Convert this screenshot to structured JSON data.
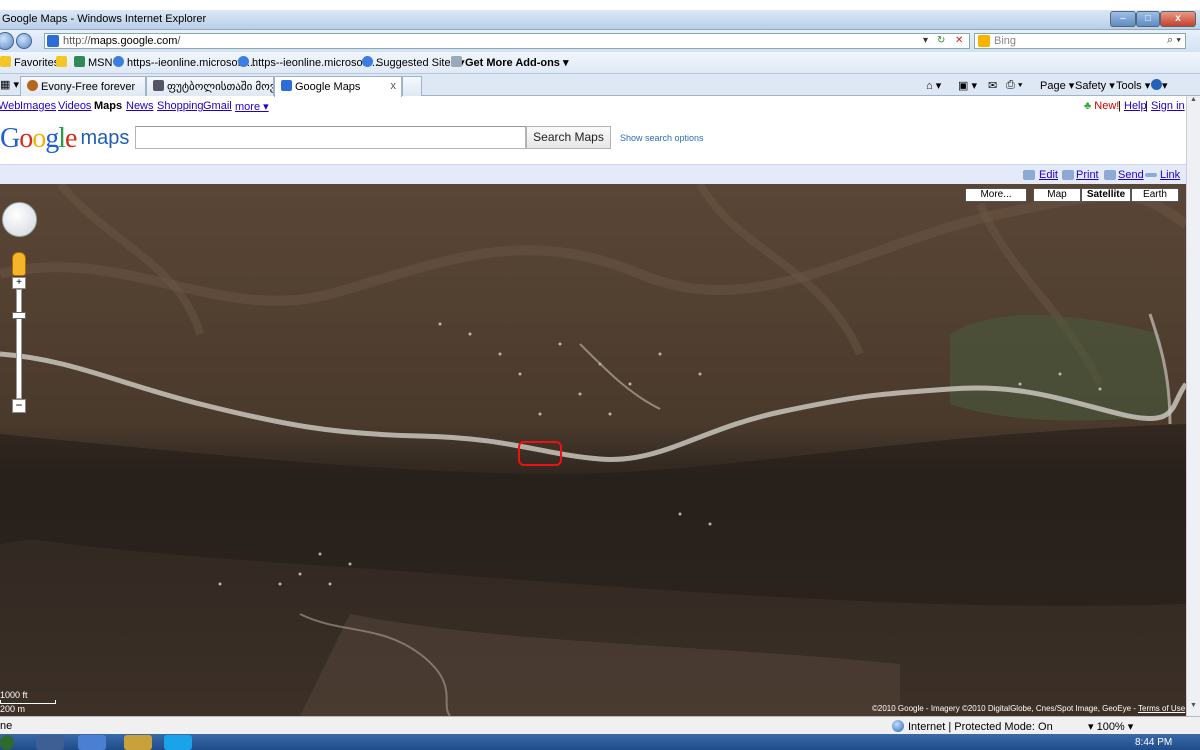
{
  "window": {
    "title": "Google Maps - Windows Internet Explorer",
    "controls": {
      "minimize": "–",
      "maximize": "□",
      "close": "x"
    }
  },
  "address_bar": {
    "url_prefix": "http://",
    "url_host": "maps.google.com",
    "url_suffix": "/",
    "search_placeholder": "Bing",
    "search_icon": "magnifier-icon"
  },
  "favorites_bar": {
    "items": [
      {
        "label": "Favorites",
        "icon": "star-icon"
      },
      {
        "label": "MSN",
        "icon": "msn-icon"
      },
      {
        "label": "https--ieonline.microsoft....",
        "icon": "ie-icon"
      },
      {
        "label": "https--ieonline.microsoft....",
        "icon": "ie-icon"
      },
      {
        "label": "Suggested Sites ▾",
        "icon": "ie-icon"
      },
      {
        "label": "Get More Add-ons ▾",
        "icon": "page-icon"
      }
    ]
  },
  "tabs": [
    {
      "label": "Evony-Free forever",
      "active": false
    },
    {
      "label": "ფუტბოლისთაში მოვის ბარველიი...",
      "active": false
    },
    {
      "label": "Google Maps",
      "active": true
    }
  ],
  "command_bar": {
    "page": "Page ▾",
    "safety": "Safety ▾",
    "tools": "Tools ▾",
    "help": "▾"
  },
  "google_nav": {
    "links": [
      "Web",
      "Images",
      "Videos",
      "Maps",
      "News",
      "Shopping",
      "Gmail",
      "more ▾"
    ],
    "current": "Maps",
    "right": {
      "new": "New!",
      "help": "Help",
      "signin": "Sign in",
      "sep": "|"
    }
  },
  "maps_header": {
    "logo_word": "Google",
    "logo_maps": "maps",
    "search_value": "",
    "search_button": "Search Maps",
    "search_options": "Show search options"
  },
  "action_links": {
    "edit": "Edit",
    "print": "Print",
    "send": "Send",
    "link": "Link"
  },
  "map": {
    "type_buttons": [
      "More...",
      "Map",
      "Satellite",
      "Earth"
    ],
    "active_type": "Satellite",
    "scale_feet": "1000 ft",
    "scale_meters": "200 m",
    "attribution_text": "©2010 Google - Imagery ©2010 DigitalGlobe, Cnes/Spot Image, GeoEye -",
    "terms_link": "Terms of Use",
    "zoom_plus": "+",
    "zoom_minus": "−",
    "colors": {
      "terrain": "#4b3a2c",
      "river": "#c9c5bc",
      "highlight": "#e11111"
    }
  },
  "status_bar": {
    "left_text": "ne",
    "zone": "Internet | Protected Mode: On",
    "zoom": "100%"
  },
  "taskbar": {
    "clock": "8:44 PM"
  }
}
